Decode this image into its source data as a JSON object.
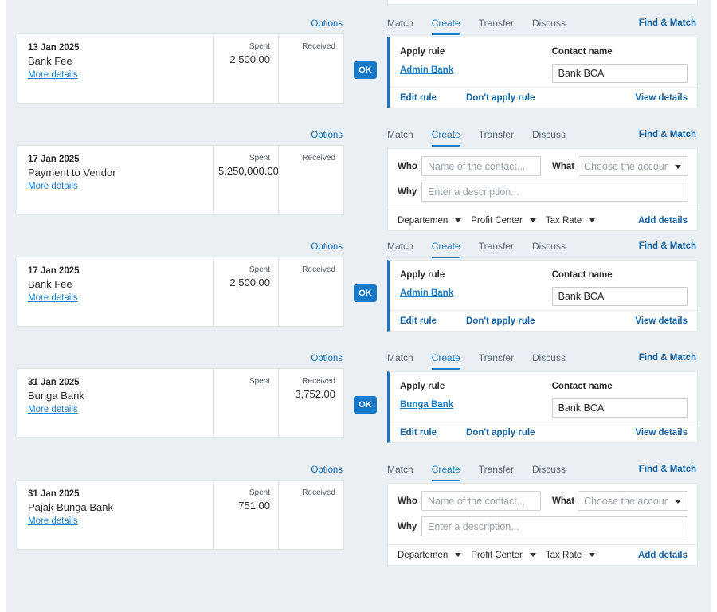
{
  "colors": {
    "accent": "#1878c8",
    "link": "#1464a5",
    "tab_active": "#1f7ec4",
    "canvas_bg": "#eaeff3",
    "card_bg": "#ffffff"
  },
  "options_label": "Options",
  "more_details_label": "More details",
  "spent_label": "Spent",
  "received_label": "Received",
  "ok_label": "OK",
  "tabs": [
    {
      "label": "Match",
      "active": false
    },
    {
      "label": "Create",
      "active": true
    },
    {
      "label": "Transfer",
      "active": false
    },
    {
      "label": "Discuss",
      "active": false
    }
  ],
  "find_match_label": "Find & Match",
  "rule_panel": {
    "apply_rule_label": "Apply rule",
    "contact_name_label": "Contact name",
    "edit_rule_label": "Edit rule",
    "dont_apply_label": "Don't apply rule",
    "view_details_label": "View details"
  },
  "create_form": {
    "who_label": "Who",
    "who_placeholder": "Name of the contact...",
    "what_label": "What",
    "what_placeholder": "Choose the account...",
    "why_label": "Why",
    "why_placeholder": "Enter a description...",
    "departemen_label": "Departemen",
    "profit_center_label": "Profit Center",
    "tax_rate_label": "Tax Rate",
    "add_details_label": "Add details"
  },
  "rows": [
    {
      "date": "13 Jan 2025",
      "description": "Bank Fee",
      "spent": "2,500.00",
      "received": "",
      "has_ok": true,
      "panel": "rule",
      "rule_name": "Admin Bank",
      "contact_value": "Bank BCA"
    },
    {
      "date": "17 Jan 2025",
      "description": "Payment to Vendor",
      "spent": "5,250,000.00",
      "received": "",
      "has_ok": false,
      "panel": "form"
    },
    {
      "date": "17 Jan 2025",
      "description": "Bank Fee",
      "spent": "2,500.00",
      "received": "",
      "has_ok": true,
      "panel": "rule",
      "rule_name": "Admin Bank",
      "contact_value": "Bank BCA"
    },
    {
      "date": "31 Jan 2025",
      "description": "Bunga Bank",
      "spent": "",
      "received": "3,752.00",
      "has_ok": true,
      "panel": "rule",
      "rule_name": "Bunga Bank",
      "contact_value": "Bank BCA"
    },
    {
      "date": "31 Jan 2025",
      "description": "Pajak Bunga Bank",
      "spent": "751.00",
      "received": "",
      "has_ok": false,
      "panel": "form"
    }
  ]
}
